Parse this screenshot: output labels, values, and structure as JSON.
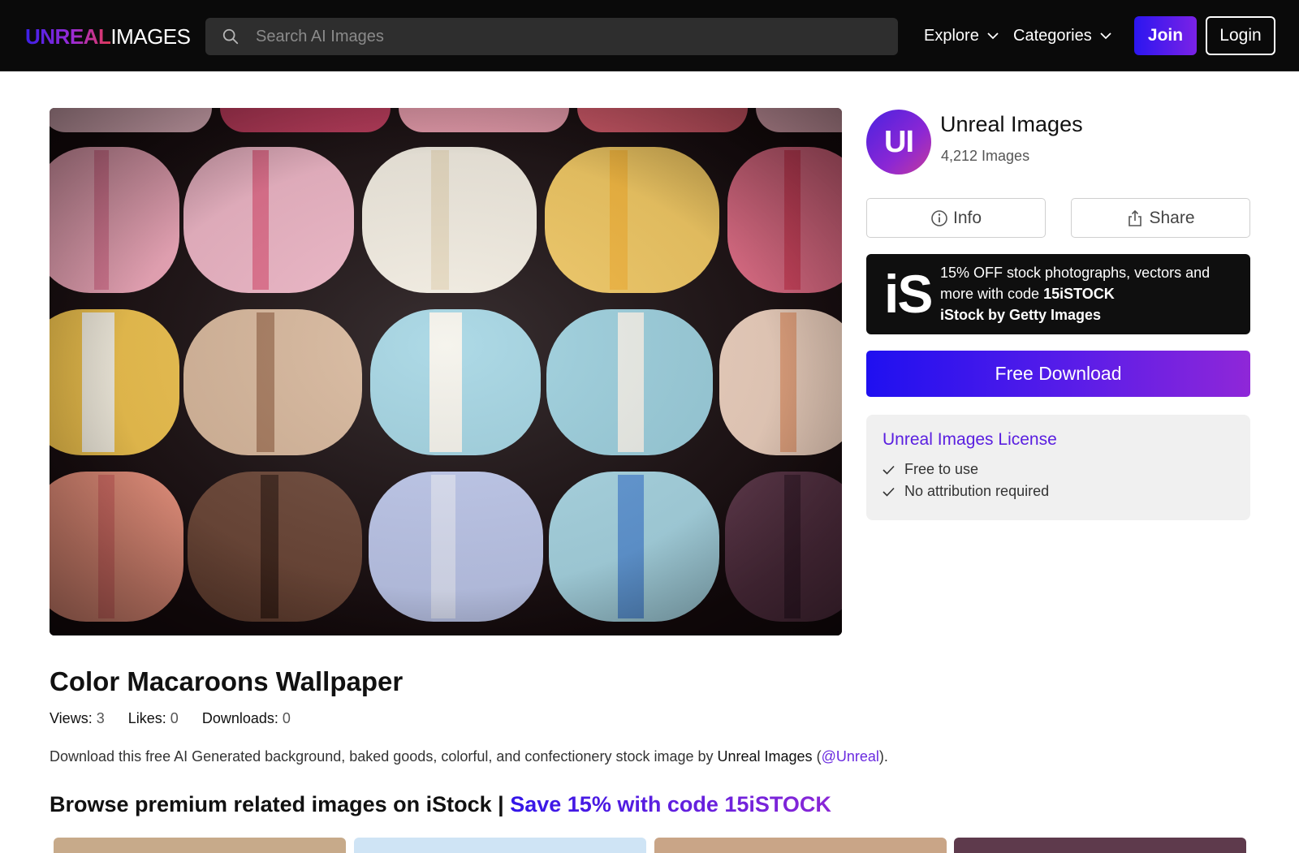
{
  "header": {
    "logo_primary": "UNREAL",
    "logo_secondary": "IMAGES",
    "search_placeholder": "Search AI Images",
    "nav": [
      {
        "label": "Explore"
      },
      {
        "label": "Categories"
      }
    ],
    "join_label": "Join",
    "login_label": "Login"
  },
  "author": {
    "avatar_initials": "UI",
    "name": "Unreal Images",
    "image_count": "4,212 Images"
  },
  "actions": {
    "info_label": "Info",
    "share_label": "Share",
    "download_label": "Free Download"
  },
  "istock_promo": {
    "logo": "iS",
    "line_prefix": "15% OFF stock photographs, vectors and more with code ",
    "code": "15iSTOCK",
    "brand": "iStock by Getty Images"
  },
  "license": {
    "title": "Unreal Images License",
    "items": [
      "Free to use",
      "No attribution required"
    ]
  },
  "image": {
    "title": "Color Macaroons Wallpaper",
    "stats": [
      {
        "label": "Views:",
        "value": "3"
      },
      {
        "label": "Likes:",
        "value": "0"
      },
      {
        "label": "Downloads:",
        "value": "0"
      }
    ],
    "description_prefix": "Download this free AI Generated background, baked goods, colorful, and confectionery stock image by ",
    "description_author": "Unreal Images",
    "description_open": " (",
    "description_handle": "@Unreal",
    "description_close": ")."
  },
  "browse": {
    "heading": "Browse premium related images on iStock | ",
    "promo": "Save 15% with code 15iSTOCK"
  },
  "colors": {
    "accent_purple": "#5a1fe0",
    "join_gradient_start": "#2b16f0",
    "header_bg": "#0a0a0a"
  }
}
